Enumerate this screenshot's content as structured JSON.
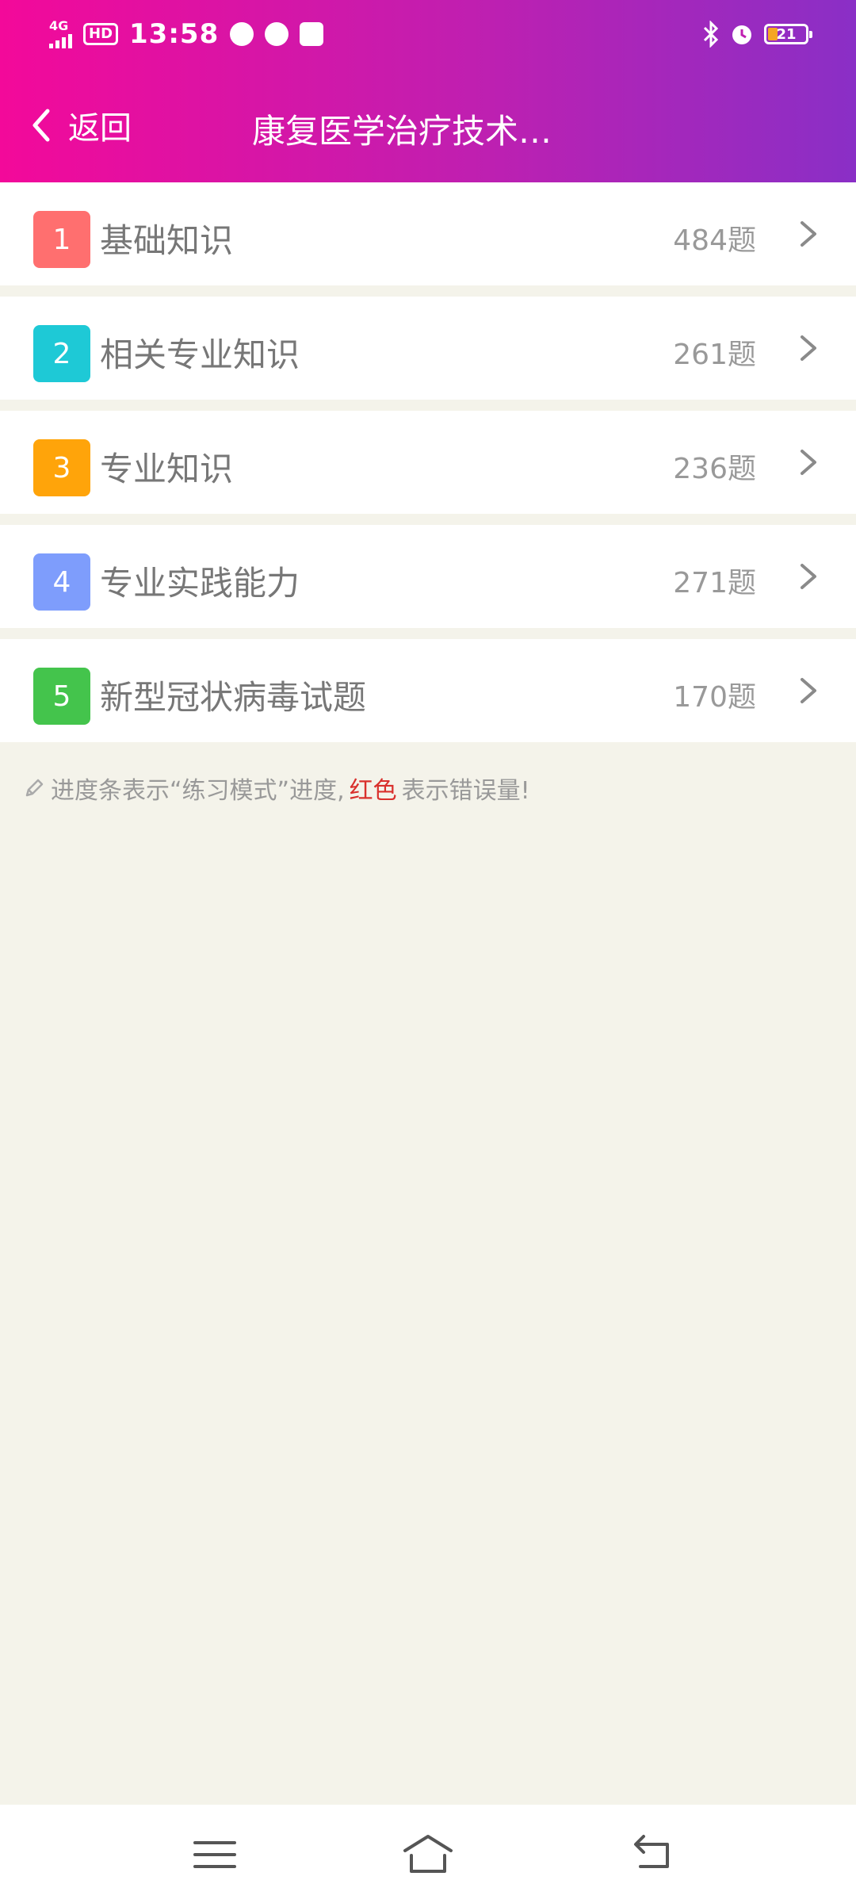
{
  "status_bar": {
    "network": "4G",
    "hd_label": "HD",
    "time": "13:58",
    "battery": "21"
  },
  "nav": {
    "back_label": "返回",
    "title": "康复医学治疗技术…"
  },
  "items": [
    {
      "index": "1",
      "name": "基础知识",
      "count": "484题",
      "color": "#ff6f6f"
    },
    {
      "index": "2",
      "name": "相关专业知识",
      "count": "261题",
      "color": "#1ec9d6"
    },
    {
      "index": "3",
      "name": "专业知识",
      "count": "236题",
      "color": "#ffa40a"
    },
    {
      "index": "4",
      "name": "专业实践能力",
      "count": "271题",
      "color": "#7e9dfc"
    },
    {
      "index": "5",
      "name": "新型冠状病毒试题",
      "count": "170题",
      "color": "#44c44c"
    }
  ],
  "note": {
    "prefix": "进度条表示“练习模式”进度,",
    "highlight": "红色",
    "suffix": "表示错误量!"
  },
  "colors": {
    "header_start": "#f3099a",
    "header_end": "#8a2fc6",
    "background": "#f4f3ea",
    "highlight": "#d9302c"
  }
}
